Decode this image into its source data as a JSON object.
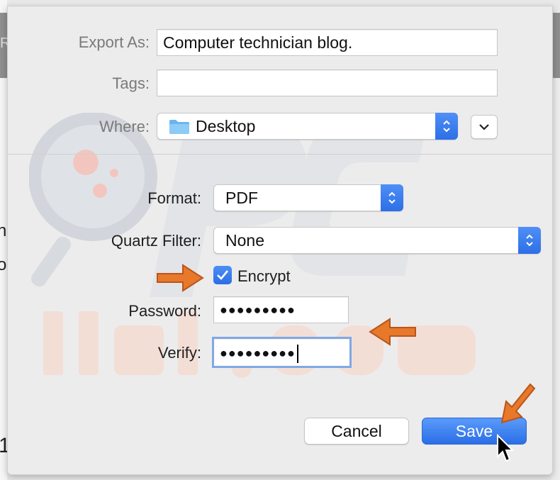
{
  "dialog": {
    "export_as": {
      "label": "Export As:",
      "value": "Computer technician blog."
    },
    "tags": {
      "label": "Tags:",
      "value": ""
    },
    "where": {
      "label": "Where:",
      "value": "Desktop",
      "folder_icon": "folder-icon"
    },
    "format": {
      "label": "Format:",
      "value": "PDF"
    },
    "quartz_filter": {
      "label": "Quartz Filter:",
      "value": "None"
    },
    "encrypt": {
      "label": "Encrypt",
      "checked": true
    },
    "password": {
      "label": "Password:",
      "value": "●●●●●●●●●"
    },
    "verify": {
      "label": "Verify:",
      "value": "●●●●●●●●●"
    },
    "buttons": {
      "cancel": "Cancel",
      "save": "Save"
    }
  },
  "background": {
    "left_glyphs": [
      "R",
      "n",
      "o",
      "1"
    ]
  },
  "watermark": {
    "text": "PC risk.com"
  },
  "colors": {
    "accent": "#2e6fe6",
    "annotation_arrow": "#e8782a",
    "sheet_bg": "#ececec"
  }
}
